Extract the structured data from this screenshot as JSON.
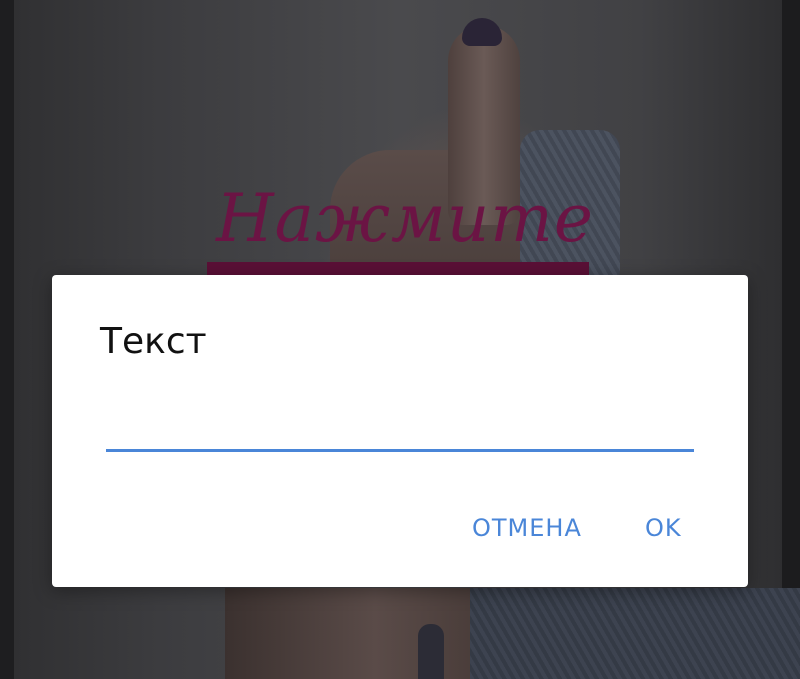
{
  "background": {
    "caption": "Нажмите"
  },
  "dialog": {
    "title": "Текст",
    "input_value": "",
    "cancel_label": "ОТМЕНА",
    "ok_label": "OK",
    "accent_color": "#4a86d8"
  }
}
